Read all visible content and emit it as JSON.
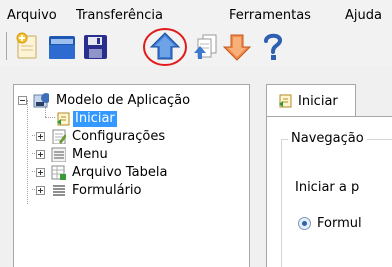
{
  "menu": {
    "items": [
      "Arquivo",
      "Transferência",
      "Ferramentas",
      "Ajuda"
    ]
  },
  "toolbar": {
    "buttons": [
      "new-icon",
      "open-folder-icon",
      "save-icon",
      "upload-arrow-icon",
      "documents-stack-icon",
      "download-arrow-icon",
      "help-icon"
    ],
    "highlight_color": "#e11b1b"
  },
  "tree": {
    "root": "Modelo de Aplicação",
    "items": [
      {
        "label": "Iniciar",
        "selected": true
      },
      {
        "label": "Configurações"
      },
      {
        "label": "Menu"
      },
      {
        "label": "Arquivo Tabela"
      },
      {
        "label": "Formulário"
      }
    ]
  },
  "tabs": {
    "active": "Iniciar"
  },
  "content": {
    "group_title": "Navegação",
    "line1": "Iniciar a p",
    "radio_label": "Formul"
  },
  "colors": {
    "selection": "#3399ff",
    "accent_blue": "#2a62b0"
  }
}
